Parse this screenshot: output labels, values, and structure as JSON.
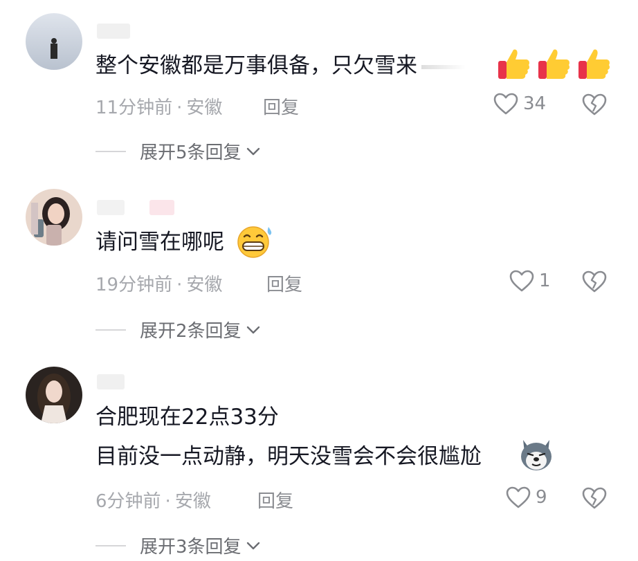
{
  "comments": [
    {
      "text_lines": [
        "整个安徽都是万事俱备，只欠雪来"
      ],
      "time": "11分钟前",
      "location": "安徽",
      "reply_label": "回复",
      "likes": "34",
      "expand": "展开5条回复"
    },
    {
      "text_lines": [
        "请问雪在哪呢"
      ],
      "time": "19分钟前",
      "location": "安徽",
      "reply_label": "回复",
      "likes": "1",
      "expand": "展开2条回复"
    },
    {
      "text_lines": [
        "合肥现在22点33分",
        "目前没一点动静，明天没雪会不会很尴尬"
      ],
      "time": "6分钟前",
      "location": "安徽",
      "reply_label": "回复",
      "likes": "9",
      "expand": "展开3条回复"
    }
  ],
  "meta_separator": "·",
  "icons": [
    "heart-icon",
    "broken-heart-icon",
    "thumbs-up-emoji",
    "grimace-sweat-emoji",
    "husky-dog-emoji",
    "chevron-down-icon"
  ],
  "colors": {
    "text": "#161823",
    "meta": "#a6a8ad",
    "icon": "#8a8c91"
  }
}
